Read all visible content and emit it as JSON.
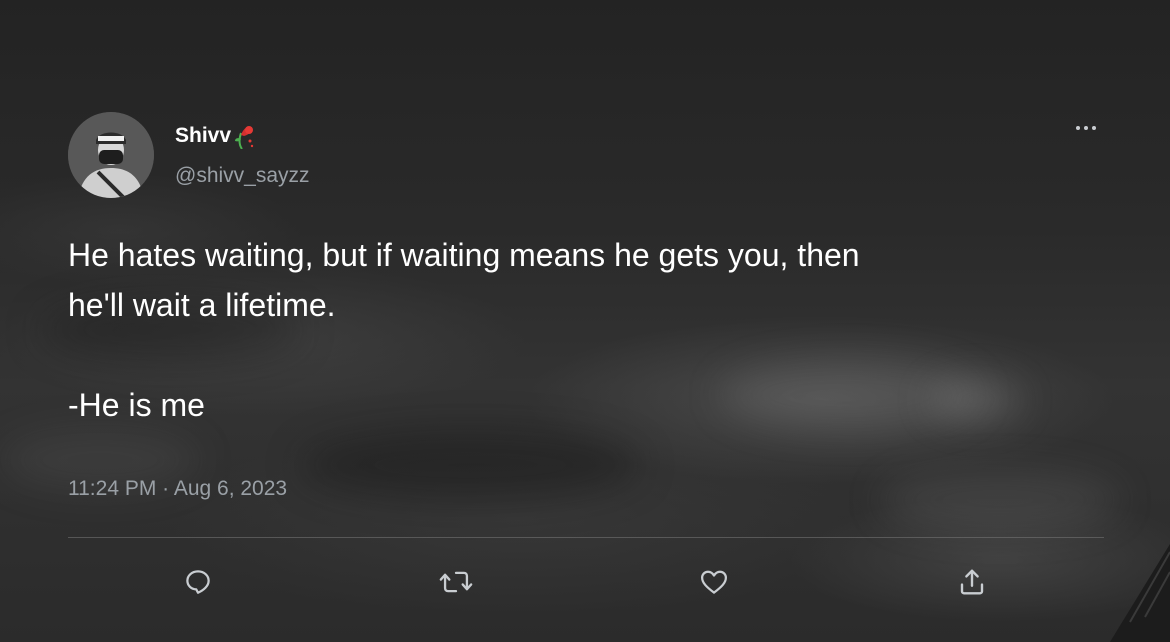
{
  "author": {
    "display_name": "Shivv",
    "name_emoji": "wilted-rose-emoji",
    "handle": "@shivv_sayzz"
  },
  "tweet": {
    "lines": [
      "He hates waiting, but if waiting means he gets you, then",
      "he'll wait a lifetime."
    ],
    "signature": "-He is me",
    "timestamp": "11:24 PM · Aug 6, 2023"
  },
  "icons": {
    "more": "more-horizontal-icon",
    "reply": "reply-icon",
    "retweet": "retweet-icon",
    "like": "heart-icon",
    "share": "share-icon"
  },
  "colors": {
    "text_primary": "#ffffff",
    "text_secondary": "#9aa0a6",
    "icon": "#c9cdd1",
    "divider": "#6b6b6b"
  }
}
